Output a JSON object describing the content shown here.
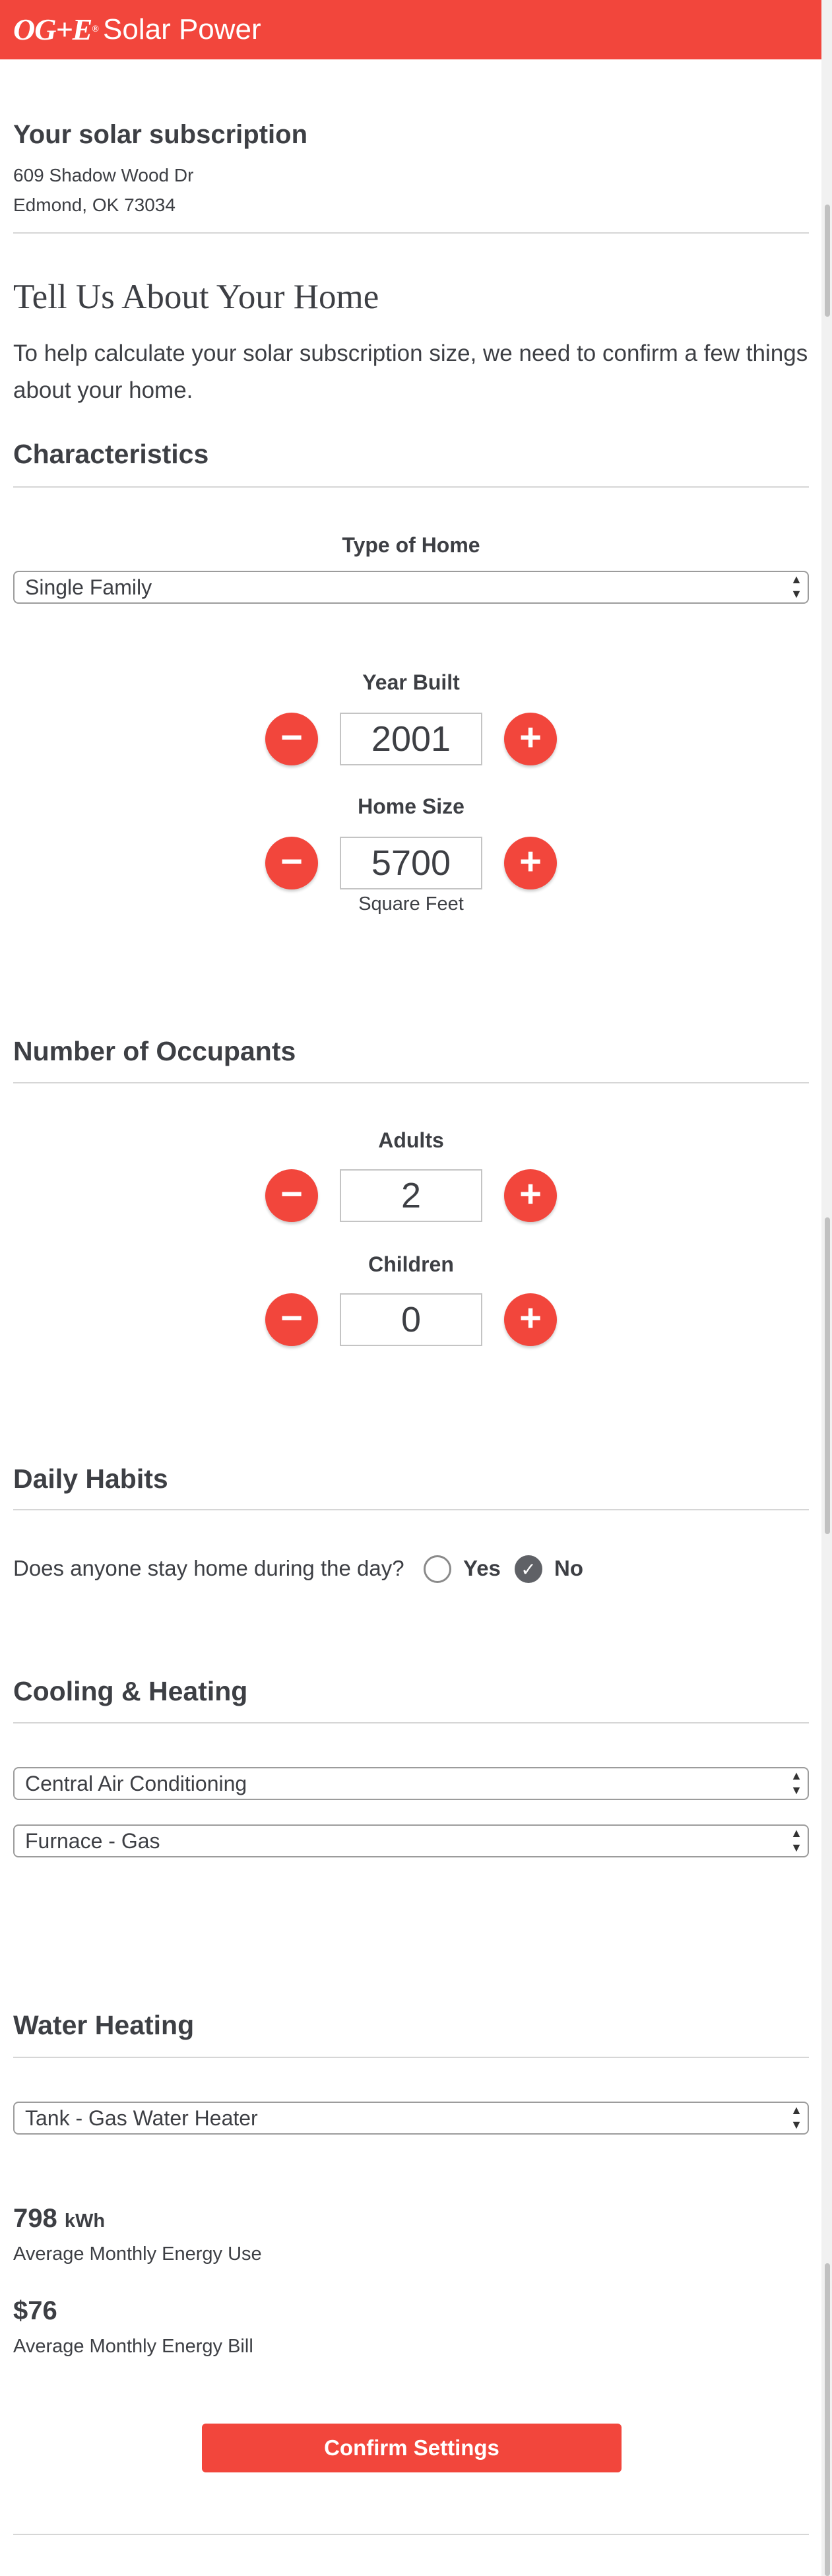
{
  "header": {
    "logo": "OG+E",
    "logo_mark": "®",
    "brand": "Solar Power"
  },
  "subscription": {
    "title": "Your solar subscription",
    "address_line1": "609 Shadow Wood Dr",
    "address_line2": "Edmond, OK 73034"
  },
  "intro": {
    "title": "Tell Us About Your Home",
    "text": "To help calculate your solar subscription size, we need to confirm a few things about your home."
  },
  "characteristics": {
    "title": "Characteristics",
    "type_label": "Type of Home",
    "type_value": "Single Family",
    "year_label": "Year Built",
    "year_value": "2001",
    "size_label": "Home Size",
    "size_value": "5700",
    "size_unit": "Square Feet"
  },
  "occupants": {
    "title": "Number of Occupants",
    "adults_label": "Adults",
    "adults_value": "2",
    "children_label": "Children",
    "children_value": "0"
  },
  "habits": {
    "title": "Daily Habits",
    "question": "Does anyone stay home during the day?",
    "yes_label": "Yes",
    "no_label": "No",
    "selected": "No"
  },
  "cooling": {
    "title": "Cooling & Heating",
    "cooling_value": "Central Air Conditioning",
    "heating_value": "Furnace - Gas"
  },
  "water": {
    "title": "Water Heating",
    "value": "Tank - Gas Water Heater"
  },
  "stats": {
    "energy_value": "798",
    "energy_unit": "kWh",
    "energy_label": "Average Monthly Energy Use",
    "bill_value": "$76",
    "bill_label": "Average Monthly Energy Bill"
  },
  "confirm_label": "Confirm Settings",
  "icons": {
    "minus": "minus-icon",
    "plus": "plus-icon",
    "select_arrows": "select-arrows-icon",
    "check": "check-icon"
  },
  "colors": {
    "accent": "#f2463c",
    "text": "#3d3f44",
    "divider": "#d6d6d6"
  }
}
